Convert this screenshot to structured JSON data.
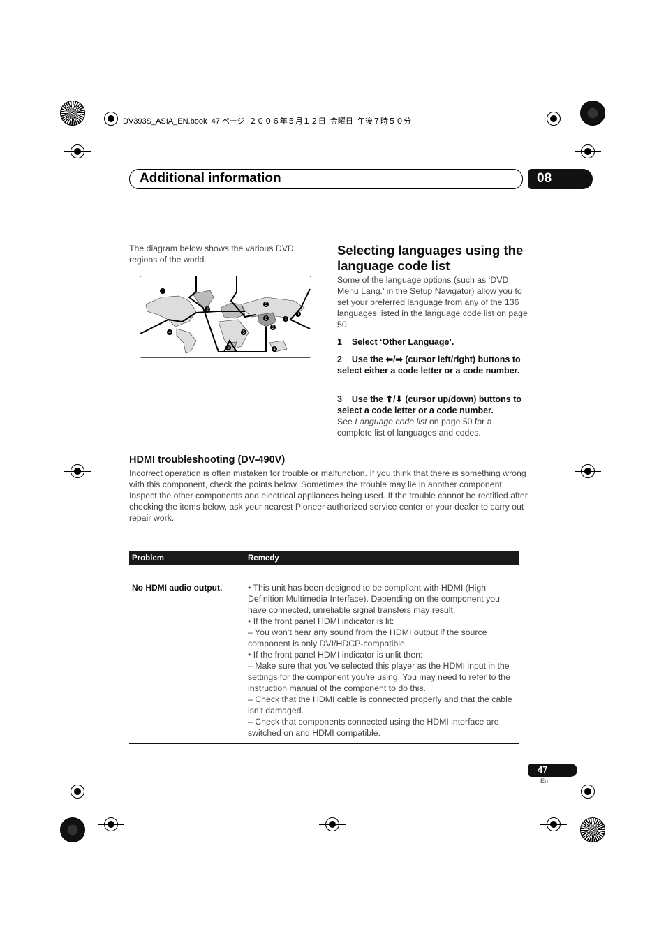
{
  "print_header": "DV393S_ASIA_EN.book  47 ページ  ２００６年５月１２日  金曜日  午後７時５０分",
  "header": {
    "title": "Additional information",
    "chapter": "08"
  },
  "left_intro": "The diagram below shows the various DVD regions of the world.",
  "map": {
    "region_labels": [
      "1",
      "2",
      "3",
      "4",
      "5",
      "6"
    ]
  },
  "language_section": {
    "title": "Selecting languages using the language code list",
    "intro": "Some of the language options (such as ‘DVD Menu Lang.’ in the Setup Navigator) allow you to set your preferred language from any of the 136 languages listed in the language code list on page 50.",
    "step1": "1    Select ‘Other Language’.",
    "step2": "2    Use the ⬅/➡ (cursor left/right) buttons to select either a code letter or a code number.",
    "step3": "3    Use the ⬆/⬇ (cursor up/down) buttons to select a code letter or a code number.",
    "note_pre": "See ",
    "note_italic": "Language code list",
    "note_post": " on page 50 for a complete list of languages and codes."
  },
  "hdmi": {
    "title": "HDMI troubleshooting (DV-490V)",
    "intro": "Incorrect operation is often mistaken for trouble or malfunction. If you think that there is something wrong with this component, check the points below. Sometimes the trouble may lie in another component. Inspect the other components and electrical appliances being used. If the trouble cannot be rectified after checking the items below, ask your nearest Pioneer authorized service center or your dealer to carry out repair work.",
    "table": {
      "headers": [
        "Problem",
        "Remedy"
      ],
      "rows": [
        {
          "problem": "No HDMI audio output.",
          "remedy": [
            "• This unit has been designed to be compliant with HDMI (High Definition Multimedia Interface). Depending on the component you have connected, unreliable signal transfers may result.",
            "• If the front panel HDMI indicator is lit:",
            "– You won’t hear any sound from the HDMI output if the source component is only DVI/HDCP-compatible.",
            "• If the front panel HDMI indicator is unlit then:",
            "– Make sure that you’ve selected this player as the HDMI input in the settings for the component you’re using. You may need to refer to the instruction manual of the component to do this.",
            "– Check that the HDMI cable is connected properly and that the cable isn’t damaged.",
            "– Check that components connected using the HDMI interface are switched on and HDMI compatible."
          ]
        }
      ]
    }
  },
  "footer": {
    "page_number": "47",
    "lang": "En"
  }
}
